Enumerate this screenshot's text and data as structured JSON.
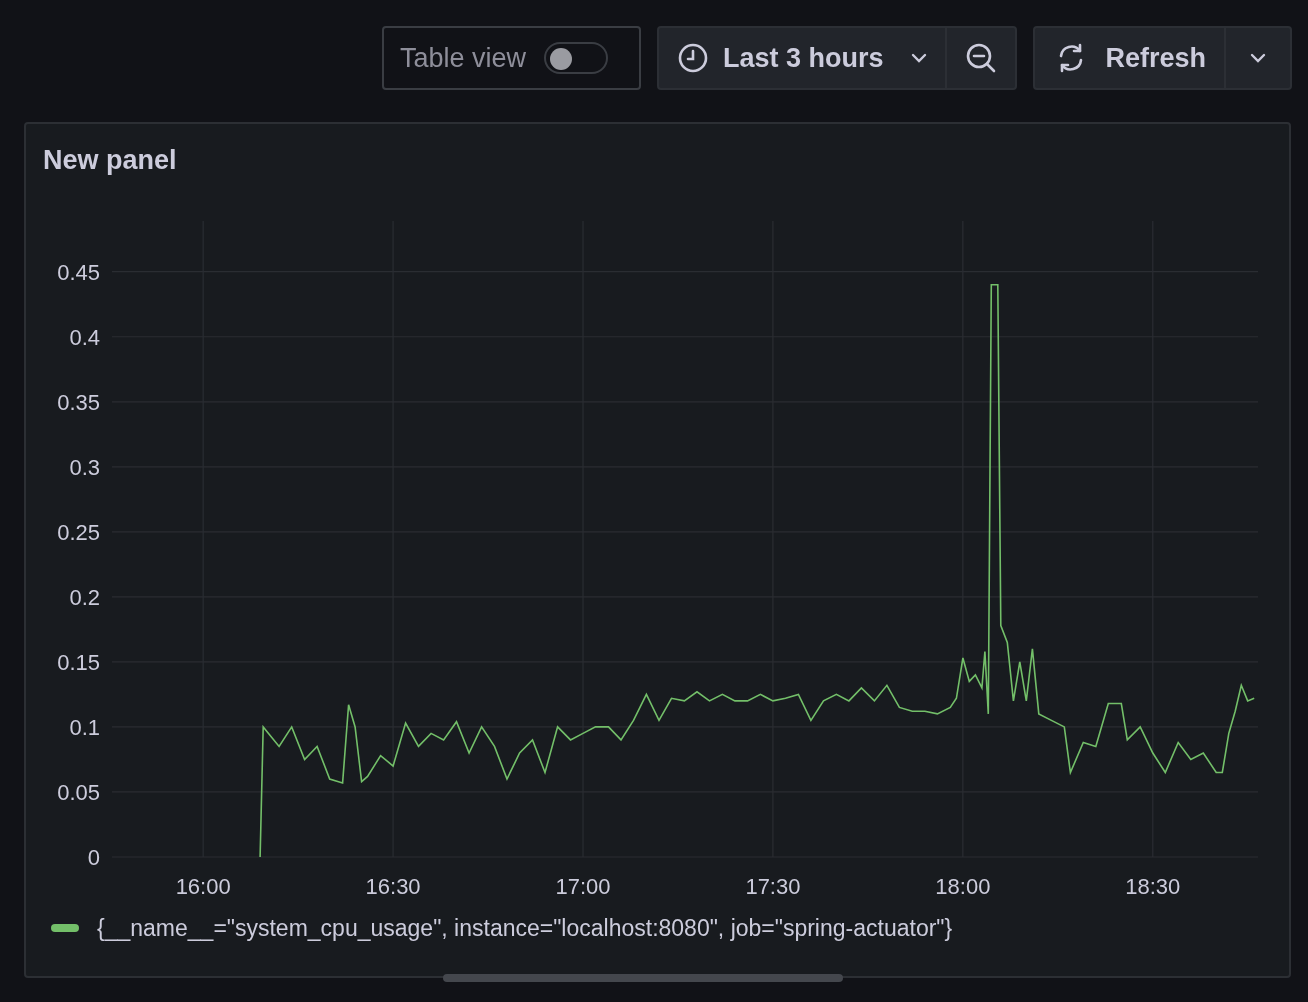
{
  "toolbar": {
    "table_view": {
      "label": "Table view",
      "on": false
    },
    "time_range": {
      "label": "Last 3 hours"
    },
    "refresh": {
      "label": "Refresh"
    }
  },
  "panel": {
    "title": "New panel",
    "chart_data": {
      "type": "line",
      "x": [
        16.15,
        16.158,
        16.2,
        16.233,
        16.267,
        16.3,
        16.333,
        16.367,
        16.383,
        16.4,
        16.417,
        16.433,
        16.467,
        16.5,
        16.533,
        16.567,
        16.6,
        16.633,
        16.667,
        16.7,
        16.733,
        16.767,
        16.8,
        16.833,
        16.867,
        16.9,
        16.933,
        16.967,
        17,
        17.033,
        17.067,
        17.1,
        17.133,
        17.167,
        17.2,
        17.233,
        17.267,
        17.3,
        17.333,
        17.367,
        17.4,
        17.433,
        17.467,
        17.5,
        17.533,
        17.567,
        17.6,
        17.633,
        17.667,
        17.7,
        17.733,
        17.767,
        17.8,
        17.833,
        17.867,
        17.9,
        17.933,
        17.967,
        17.983,
        18,
        18.017,
        18.033,
        18.05,
        18.058,
        18.067,
        18.075,
        18.092,
        18.1,
        18.117,
        18.133,
        18.15,
        18.167,
        18.183,
        18.2,
        18.233,
        18.267,
        18.283,
        18.317,
        18.35,
        18.383,
        18.417,
        18.433,
        18.467,
        18.5,
        18.533,
        18.567,
        18.6,
        18.633,
        18.667,
        18.683,
        18.7,
        18.717,
        18.733,
        18.75,
        18.767
      ],
      "series": [
        {
          "name": "{__name__=\"system_cpu_usage\", instance=\"localhost:8080\", job=\"spring-actuator\"}",
          "color": "#73bf69",
          "values": [
            0,
            0.1,
            0.085,
            0.1,
            0.075,
            0.085,
            0.06,
            0.057,
            0.117,
            0.1,
            0.058,
            0.062,
            0.078,
            0.07,
            0.103,
            0.085,
            0.095,
            0.09,
            0.104,
            0.08,
            0.1,
            0.085,
            0.06,
            0.08,
            0.09,
            0.065,
            0.1,
            0.09,
            0.095,
            0.1,
            0.1,
            0.09,
            0.105,
            0.125,
            0.105,
            0.122,
            0.12,
            0.127,
            0.12,
            0.125,
            0.12,
            0.12,
            0.125,
            0.12,
            0.122,
            0.125,
            0.105,
            0.12,
            0.125,
            0.12,
            0.13,
            0.12,
            0.132,
            0.115,
            0.112,
            0.112,
            0.11,
            0.115,
            0.122,
            0.153,
            0.135,
            0.14,
            0.13,
            0.158,
            0.11,
            0.44,
            0.44,
            0.178,
            0.165,
            0.12,
            0.15,
            0.12,
            0.16,
            0.11,
            0.105,
            0.1,
            0.065,
            0.088,
            0.085,
            0.118,
            0.118,
            0.09,
            0.1,
            0.08,
            0.065,
            0.088,
            0.075,
            0.08,
            0.065,
            0.065,
            0.095,
            0.112,
            0.132,
            0.12,
            0.122
          ]
        }
      ],
      "grid": true,
      "xlim": [
        15.76,
        18.777
      ],
      "ylim": [
        0,
        0.489
      ],
      "xticks": [
        {
          "value": 16,
          "label": "16:00"
        },
        {
          "value": 16.5,
          "label": "16:30"
        },
        {
          "value": 17,
          "label": "17:00"
        },
        {
          "value": 17.5,
          "label": "17:30"
        },
        {
          "value": 18,
          "label": "18:00"
        },
        {
          "value": 18.5,
          "label": "18:30"
        }
      ],
      "yticks": [
        {
          "value": 0,
          "label": "0"
        },
        {
          "value": 0.05,
          "label": "0.05"
        },
        {
          "value": 0.1,
          "label": "0.1"
        },
        {
          "value": 0.15,
          "label": "0.15"
        },
        {
          "value": 0.2,
          "label": "0.2"
        },
        {
          "value": 0.25,
          "label": "0.25"
        },
        {
          "value": 0.3,
          "label": "0.3"
        },
        {
          "value": 0.35,
          "label": "0.35"
        },
        {
          "value": 0.4,
          "label": "0.4"
        },
        {
          "value": 0.45,
          "label": "0.45"
        }
      ]
    }
  }
}
